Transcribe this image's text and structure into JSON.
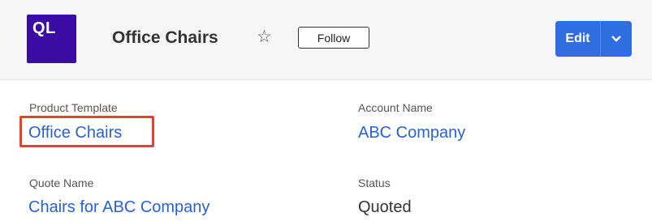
{
  "header": {
    "avatar_text": "QL",
    "avatar_color": "#3a0ca3",
    "title": "Office Chairs",
    "follow_label": "Follow",
    "edit_label": "Edit",
    "accent_color": "#2f6de1"
  },
  "icons": {
    "star": "star-outline-icon",
    "caret": "chevron-down-icon"
  },
  "fields": {
    "product_template": {
      "label": "Product Template",
      "value": "Office Chairs"
    },
    "account_name": {
      "label": "Account Name",
      "value": "ABC Company"
    },
    "quote_name": {
      "label": "Quote Name",
      "value": "Chairs for ABC Company"
    },
    "status": {
      "label": "Status",
      "value": "Quoted"
    }
  },
  "highlight_color": "#e8412c"
}
